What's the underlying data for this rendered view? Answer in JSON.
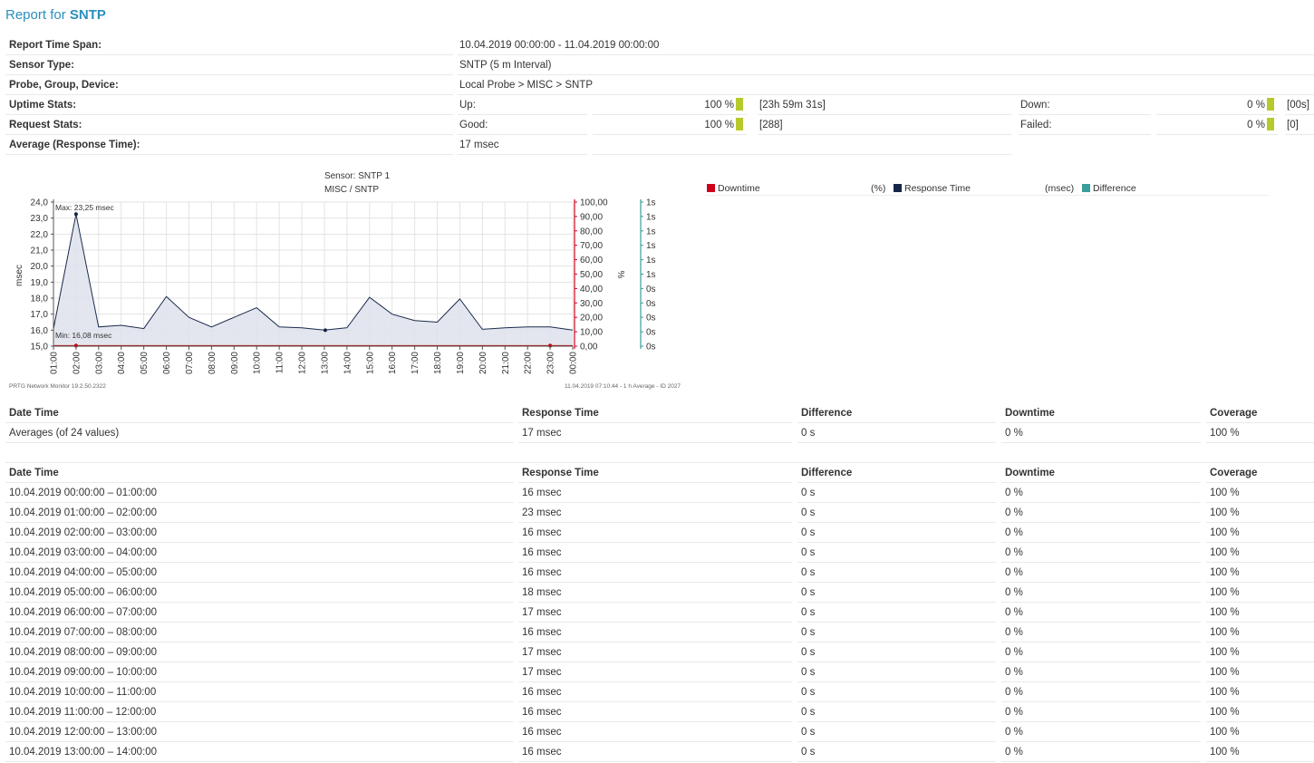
{
  "header": {
    "title_prefix": "Report for ",
    "title_sensor": "SNTP"
  },
  "summary": {
    "time_span_label": "Report Time Span:",
    "time_span_value": "10.04.2019 00:00:00 - 11.04.2019 00:00:00",
    "sensor_type_label": "Sensor Type:",
    "sensor_type_value": "SNTP (5 m Interval)",
    "probe_label": "Probe, Group, Device:",
    "probe_value": "Local Probe > MISC > SNTP",
    "uptime_label": "Uptime Stats:",
    "uptime_up_label": "Up:",
    "uptime_up_pct": "100 %",
    "uptime_up_time": "[23h 59m 31s]",
    "uptime_down_label": "Down:",
    "uptime_down_pct": "0 %",
    "uptime_down_time": "[00s]",
    "request_label": "Request Stats:",
    "request_good_label": "Good:",
    "request_good_pct": "100 %",
    "request_good_count": "[288]",
    "request_failed_label": "Failed:",
    "request_failed_pct": "0 %",
    "request_failed_count": "[0]",
    "avg_label": "Average (Response Time):",
    "avg_value": "17 msec",
    "bar_color": "#b7c92b"
  },
  "chart_data": {
    "type": "area",
    "title": "Sensor: SNTP 1",
    "subtitle": "MISC / SNTP",
    "ylabel": "msec",
    "y2label": "%",
    "categories": [
      "01:00",
      "02:00",
      "03:00",
      "04:00",
      "05:00",
      "06:00",
      "07:00",
      "08:00",
      "09:00",
      "10:00",
      "11:00",
      "12:00",
      "13:00",
      "14:00",
      "15:00",
      "16:00",
      "17:00",
      "18:00",
      "19:00",
      "20:00",
      "21:00",
      "22:00",
      "23:00",
      "00:00"
    ],
    "series": [
      {
        "name": "Response Time",
        "color": "#1a2b4c",
        "values": [
          16.08,
          23.25,
          16.2,
          16.3,
          16.1,
          18.1,
          16.8,
          16.2,
          16.8,
          17.4,
          16.2,
          16.15,
          16.0,
          16.15,
          18.05,
          17.0,
          16.6,
          16.5,
          17.95,
          16.05,
          16.15,
          16.2,
          16.2,
          16.0
        ]
      },
      {
        "name": "Downtime",
        "color": "#cc0000",
        "values": [
          0,
          0,
          0,
          0,
          0,
          0,
          0,
          0,
          0,
          0,
          0,
          0,
          0,
          0,
          0,
          0,
          0,
          0,
          0,
          0,
          0,
          0,
          0,
          0
        ]
      }
    ],
    "ylim": [
      15.0,
      24.0
    ],
    "y_ticks": [
      "24,0",
      "23,0",
      "22,0",
      "21,0",
      "20,0",
      "19,0",
      "18,0",
      "17,0",
      "16,0",
      "15,0"
    ],
    "y2lim": [
      0,
      100
    ],
    "y2_ticks": [
      "100,00",
      "90,00",
      "80,00",
      "70,00",
      "60,00",
      "50,00",
      "40,00",
      "30,00",
      "20,00",
      "10,00",
      "0,00"
    ],
    "y3_ticks": [
      "1s",
      "1s",
      "1s",
      "1s",
      "1s",
      "1s",
      "0s",
      "0s",
      "0s",
      "0s",
      "0s"
    ],
    "max_label": "Max: 23,25 msec",
    "min_label": "Min: 16,08 msec",
    "footer_left": "PRTG Network Monitor 19.2.50.2322",
    "footer_right": "11.04.2019 07:10:44 - 1 h Average - ID 2027"
  },
  "legend": {
    "downtime": "Downtime",
    "downtime_unit": "(%)",
    "downtime_color": "#d0021b",
    "response": "Response Time",
    "response_unit": "(msec)",
    "response_color": "#14264a",
    "difference": "Difference",
    "difference_color": "#3a9e9a"
  },
  "averages_table": {
    "headers": [
      "Date Time",
      "Response Time",
      "Difference",
      "Downtime",
      "Coverage"
    ],
    "row": [
      "Averages (of 24 values)",
      "17 msec",
      "0 s",
      "0 %",
      "100 %"
    ]
  },
  "detail_table": {
    "headers": [
      "Date Time",
      "Response Time",
      "Difference",
      "Downtime",
      "Coverage"
    ],
    "rows": [
      [
        "10.04.2019 00:00:00 – 01:00:00",
        "16 msec",
        "0 s",
        "0 %",
        "100 %"
      ],
      [
        "10.04.2019 01:00:00 – 02:00:00",
        "23 msec",
        "0 s",
        "0 %",
        "100 %"
      ],
      [
        "10.04.2019 02:00:00 – 03:00:00",
        "16 msec",
        "0 s",
        "0 %",
        "100 %"
      ],
      [
        "10.04.2019 03:00:00 – 04:00:00",
        "16 msec",
        "0 s",
        "0 %",
        "100 %"
      ],
      [
        "10.04.2019 04:00:00 – 05:00:00",
        "16 msec",
        "0 s",
        "0 %",
        "100 %"
      ],
      [
        "10.04.2019 05:00:00 – 06:00:00",
        "18 msec",
        "0 s",
        "0 %",
        "100 %"
      ],
      [
        "10.04.2019 06:00:00 – 07:00:00",
        "17 msec",
        "0 s",
        "0 %",
        "100 %"
      ],
      [
        "10.04.2019 07:00:00 – 08:00:00",
        "16 msec",
        "0 s",
        "0 %",
        "100 %"
      ],
      [
        "10.04.2019 08:00:00 – 09:00:00",
        "17 msec",
        "0 s",
        "0 %",
        "100 %"
      ],
      [
        "10.04.2019 09:00:00 – 10:00:00",
        "17 msec",
        "0 s",
        "0 %",
        "100 %"
      ],
      [
        "10.04.2019 10:00:00 – 11:00:00",
        "16 msec",
        "0 s",
        "0 %",
        "100 %"
      ],
      [
        "10.04.2019 11:00:00 – 12:00:00",
        "16 msec",
        "0 s",
        "0 %",
        "100 %"
      ],
      [
        "10.04.2019 12:00:00 – 13:00:00",
        "16 msec",
        "0 s",
        "0 %",
        "100 %"
      ],
      [
        "10.04.2019 13:00:00 – 14:00:00",
        "16 msec",
        "0 s",
        "0 %",
        "100 %"
      ]
    ]
  }
}
